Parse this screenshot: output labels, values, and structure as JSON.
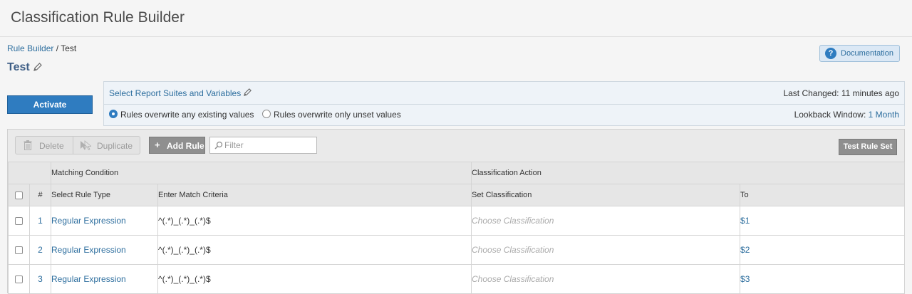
{
  "header": {
    "title": "Classification Rule Builder"
  },
  "breadcrumb": {
    "parent": "Rule Builder",
    "separator": "/",
    "current": "Test"
  },
  "rule_set": {
    "title": "Test"
  },
  "documentation_button": {
    "label": "Documentation",
    "icon": "question-icon"
  },
  "activate_button": {
    "label": "Activate"
  },
  "config": {
    "select_report_suites": "Select Report Suites and Variables",
    "last_changed": "Last Changed: 11 minutes ago",
    "overwrite_options": [
      {
        "label": "Rules overwrite any existing values",
        "selected": true
      },
      {
        "label": "Rules overwrite only unset values",
        "selected": false
      }
    ],
    "lookback_label": "Lookback Window:",
    "lookback_value": "1 Month"
  },
  "toolbar": {
    "delete_label": "Delete",
    "duplicate_label": "Duplicate",
    "add_rule_label": "Add Rule",
    "filter_placeholder": "Filter",
    "test_rule_set_label": "Test Rule Set"
  },
  "table": {
    "group_headers": {
      "matching": "Matching Condition",
      "action": "Classification Action"
    },
    "columns": {
      "number": "#",
      "rule_type": "Select Rule Type",
      "match_criteria": "Enter Match Criteria",
      "set_classification": "Set Classification",
      "to": "To"
    },
    "rows": [
      {
        "number": "1",
        "rule_type": "Regular Expression",
        "criteria": "^(.*)_(.*)_(.*)$",
        "classification": "Choose Classification",
        "to": "$1"
      },
      {
        "number": "2",
        "rule_type": "Regular Expression",
        "criteria": "^(.*)_(.*)_(.*)$",
        "classification": "Choose Classification",
        "to": "$2"
      },
      {
        "number": "3",
        "rule_type": "Regular Expression",
        "criteria": "^(.*)_(.*)_(.*)$",
        "classification": "Choose Classification",
        "to": "$3"
      }
    ]
  },
  "colors": {
    "accent": "#2f7cc0",
    "link": "#2d6e9e",
    "title": "#3f5f86"
  }
}
